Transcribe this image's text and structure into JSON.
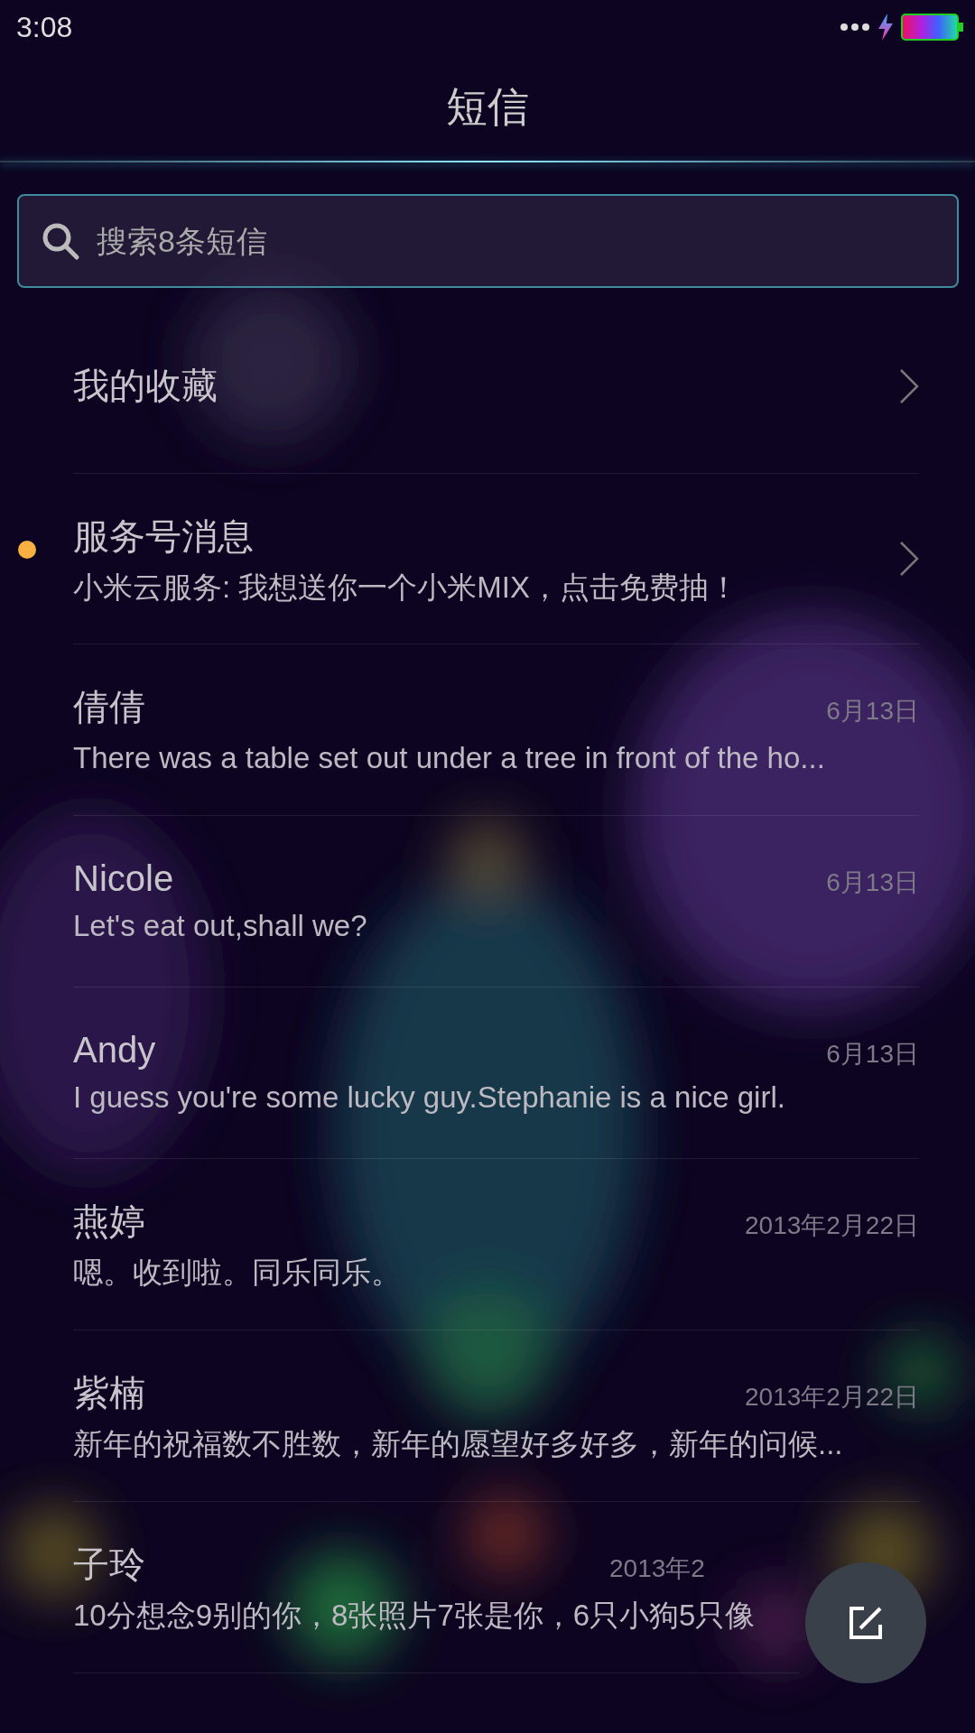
{
  "status_bar": {
    "time": "3:08"
  },
  "title": "短信",
  "search": {
    "placeholder": "搜索8条短信"
  },
  "entries": [
    {
      "kind": "folder",
      "name": "我的收藏",
      "unread": false
    },
    {
      "kind": "folder",
      "name": "服务号消息",
      "preview": "小米云服务: 我想送你一个小米MIX，点击免费抽！",
      "unread": true
    }
  ],
  "conversations": [
    {
      "name": "倩倩",
      "date": "6月13日",
      "preview": "There was a table set out under a tree in front of the ho..."
    },
    {
      "name": "Nicole",
      "date": "6月13日",
      "preview": "Let's eat out,shall we?"
    },
    {
      "name": "Andy",
      "date": "6月13日",
      "preview": "I guess you're some lucky guy.Stephanie is a nice girl."
    },
    {
      "name": "燕婷",
      "date": "2013年2月22日",
      "preview": "嗯。收到啦。同乐同乐。"
    },
    {
      "name": "紫楠",
      "date": "2013年2月22日",
      "preview": "新年的祝福数不胜数，新年的愿望好多好多，新年的问候..."
    },
    {
      "name": "子玲",
      "date": "2013年2",
      "preview": "10分想念9别的你，8张照片7张是你，6只小狗5只像"
    }
  ]
}
